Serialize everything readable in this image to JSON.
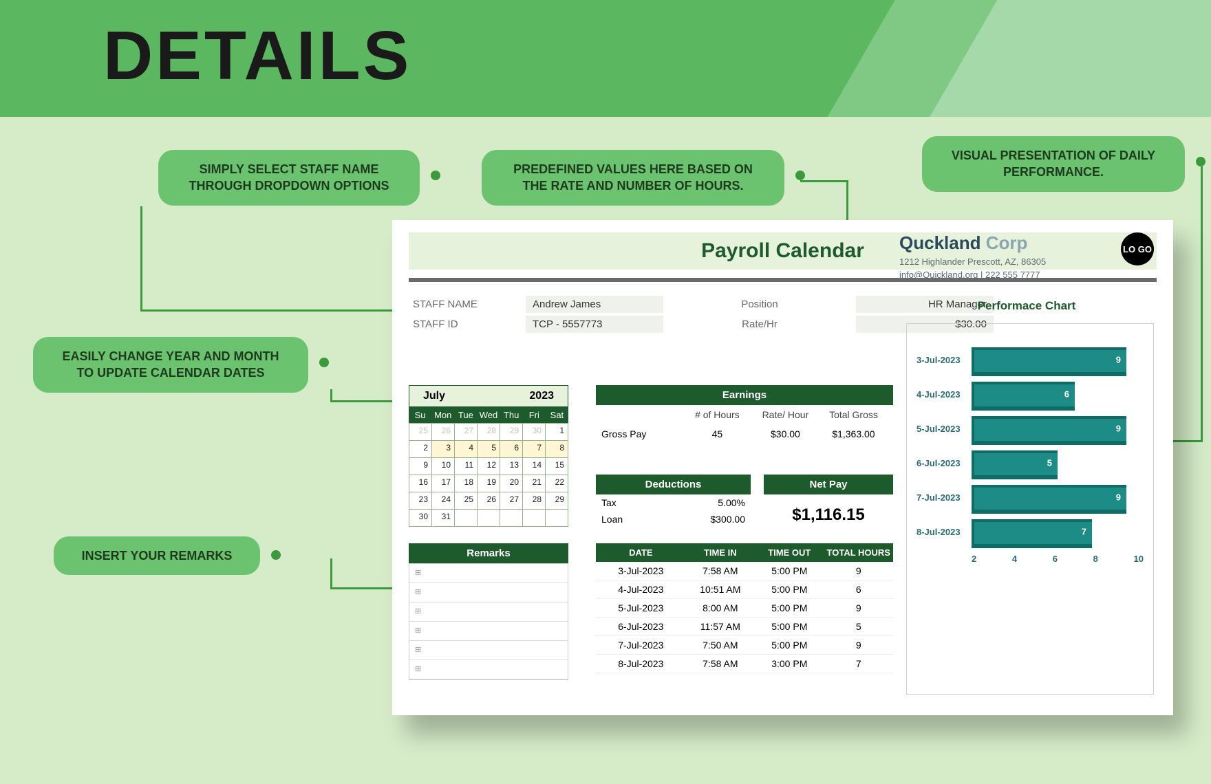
{
  "header": {
    "title": "DETAILS"
  },
  "callouts": {
    "staff_dropdown": "SIMPLY SELECT STAFF NAME THROUGH DROPDOWN OPTIONS",
    "predefined": "PREDEFINED VALUES HERE BASED ON THE RATE AND NUMBER OF HOURS.",
    "visual": "VISUAL PRESENTATION OF DAILY PERFORMANCE.",
    "year_month": "EASILY CHANGE YEAR AND MONTH TO UPDATE CALENDAR DATES",
    "remarks": "INSERT YOUR REMARKS"
  },
  "sheet": {
    "title": "Payroll Calendar",
    "staff": {
      "name_lbl": "STAFF NAME",
      "name": "Andrew James",
      "id_lbl": "STAFF ID",
      "id": "TCP - 5557773",
      "position_lbl": "Position",
      "position": "HR Manager",
      "rate_lbl": "Rate/Hr",
      "rate": "$30.00"
    },
    "company": {
      "name1": "Quckland",
      "name2": "Corp",
      "addr": "1212 Highlander Prescott, AZ, 86305",
      "contact": "info@Quickland.org | 222 555 7777",
      "logo": "LO GO"
    },
    "calendar": {
      "month": "July",
      "year": "2023",
      "dow": [
        "Su",
        "Mon",
        "Tue",
        "Wed",
        "Thu",
        "Fri",
        "Sat"
      ],
      "cells": [
        {
          "v": "25",
          "cls": "faded"
        },
        {
          "v": "26",
          "cls": "faded"
        },
        {
          "v": "27",
          "cls": "faded"
        },
        {
          "v": "28",
          "cls": "faded"
        },
        {
          "v": "29",
          "cls": "faded"
        },
        {
          "v": "30",
          "cls": "faded"
        },
        {
          "v": "1",
          "cls": ""
        },
        {
          "v": "2",
          "cls": ""
        },
        {
          "v": "3",
          "cls": "hl"
        },
        {
          "v": "4",
          "cls": "hl"
        },
        {
          "v": "5",
          "cls": "hl"
        },
        {
          "v": "6",
          "cls": "hl"
        },
        {
          "v": "7",
          "cls": "hl"
        },
        {
          "v": "8",
          "cls": "hl"
        },
        {
          "v": "9",
          "cls": ""
        },
        {
          "v": "10",
          "cls": ""
        },
        {
          "v": "11",
          "cls": ""
        },
        {
          "v": "12",
          "cls": ""
        },
        {
          "v": "13",
          "cls": ""
        },
        {
          "v": "14",
          "cls": ""
        },
        {
          "v": "15",
          "cls": ""
        },
        {
          "v": "16",
          "cls": ""
        },
        {
          "v": "17",
          "cls": ""
        },
        {
          "v": "18",
          "cls": ""
        },
        {
          "v": "19",
          "cls": ""
        },
        {
          "v": "20",
          "cls": ""
        },
        {
          "v": "21",
          "cls": ""
        },
        {
          "v": "22",
          "cls": ""
        },
        {
          "v": "23",
          "cls": ""
        },
        {
          "v": "24",
          "cls": ""
        },
        {
          "v": "25",
          "cls": ""
        },
        {
          "v": "26",
          "cls": ""
        },
        {
          "v": "27",
          "cls": ""
        },
        {
          "v": "28",
          "cls": ""
        },
        {
          "v": "29",
          "cls": ""
        },
        {
          "v": "30",
          "cls": ""
        },
        {
          "v": "31",
          "cls": ""
        },
        {
          "v": "",
          "cls": ""
        },
        {
          "v": "",
          "cls": ""
        },
        {
          "v": "",
          "cls": ""
        },
        {
          "v": "",
          "cls": ""
        },
        {
          "v": "",
          "cls": ""
        }
      ]
    },
    "earnings": {
      "title": "Earnings",
      "headers": [
        "",
        "# of Hours",
        "Rate/ Hour",
        "Total Gross"
      ],
      "label": "Gross Pay",
      "hours": "45",
      "rate": "$30.00",
      "total": "$1,363.00"
    },
    "deductions": {
      "title": "Deductions",
      "rows": [
        {
          "l": "Tax",
          "v": "5.00%"
        },
        {
          "l": "Loan",
          "v": "$300.00"
        }
      ]
    },
    "netpay": {
      "title": "Net Pay",
      "value": "$1,116.15"
    },
    "log": {
      "headers": [
        "DATE",
        "TIME IN",
        "TIME OUT",
        "TOTAL HOURS"
      ],
      "rows": [
        {
          "d": "3-Jul-2023",
          "in": "7:58 AM",
          "out": "5:00 PM",
          "h": "9"
        },
        {
          "d": "4-Jul-2023",
          "in": "10:51 AM",
          "out": "5:00 PM",
          "h": "6"
        },
        {
          "d": "5-Jul-2023",
          "in": "8:00 AM",
          "out": "5:00 PM",
          "h": "9"
        },
        {
          "d": "6-Jul-2023",
          "in": "11:57 AM",
          "out": "5:00 PM",
          "h": "5"
        },
        {
          "d": "7-Jul-2023",
          "in": "7:50 AM",
          "out": "5:00 PM",
          "h": "9"
        },
        {
          "d": "8-Jul-2023",
          "in": "7:58 AM",
          "out": "3:00 PM",
          "h": "7"
        }
      ]
    },
    "remarks": {
      "title": "Remarks",
      "placeholder": "⊞"
    },
    "chart": {
      "title": "Performace Chart",
      "axis": [
        "2",
        "4",
        "6",
        "8",
        "10"
      ]
    }
  },
  "chart_data": {
    "type": "bar",
    "title": "Performace Chart",
    "xlabel": "",
    "ylabel": "",
    "ylim": [
      0,
      10
    ],
    "categories": [
      "3-Jul-2023",
      "4-Jul-2023",
      "5-Jul-2023",
      "6-Jul-2023",
      "7-Jul-2023",
      "8-Jul-2023"
    ],
    "values": [
      9,
      6,
      9,
      5,
      9,
      7
    ]
  }
}
